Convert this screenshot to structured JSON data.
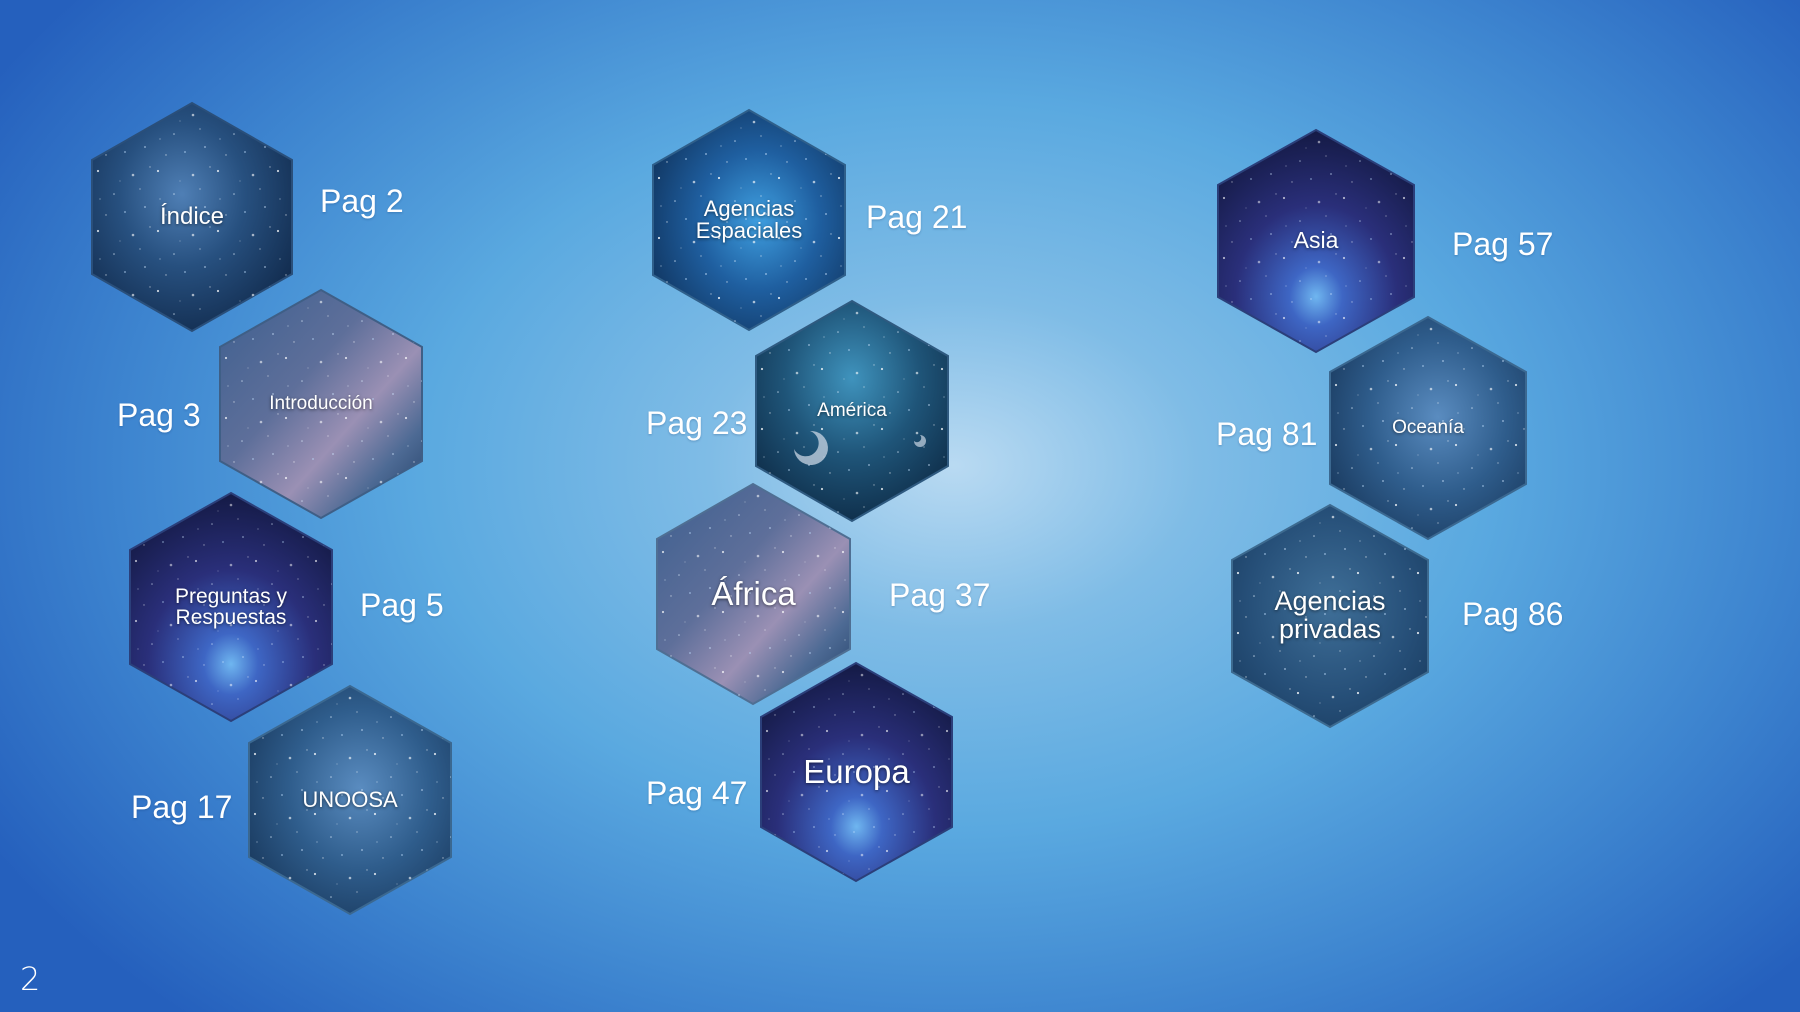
{
  "slide": {
    "number": "2"
  },
  "colors": {
    "text": "#ffffff",
    "background_center": "#b9daf2",
    "background_edge": "#2560bd"
  },
  "items": [
    {
      "id": "indice",
      "label": "Índice",
      "page": "Pag 2",
      "icon": "nebula-hexagon-icon"
    },
    {
      "id": "introduccion",
      "label": "Introducción",
      "page": "Pag 3",
      "icon": "milky-way-hexagon-icon"
    },
    {
      "id": "preguntas",
      "label": "Preguntas y\nRespuestas",
      "page": "Pag 5",
      "icon": "galaxy-hexagon-icon"
    },
    {
      "id": "unoosa",
      "label": "UNOOSA",
      "page": "Pag 17",
      "icon": "nebula-hexagon-icon"
    },
    {
      "id": "agencias-espaciales",
      "label": "Agencias\nEspaciales",
      "page": "Pag 21",
      "icon": "star-cluster-hexagon-icon"
    },
    {
      "id": "america",
      "label": "América",
      "page": "Pag 23",
      "icon": "planet-hexagon-icon"
    },
    {
      "id": "africa",
      "label": "África",
      "page": "Pag 37",
      "icon": "milky-way-hexagon-icon"
    },
    {
      "id": "europa",
      "label": "Europa",
      "page": "Pag 47",
      "icon": "galaxy-hexagon-icon"
    },
    {
      "id": "asia",
      "label": "Asia",
      "page": "Pag 57",
      "icon": "galaxy-hexagon-icon"
    },
    {
      "id": "oceania",
      "label": "Oceanía",
      "page": "Pag 81",
      "icon": "nebula-hexagon-icon"
    },
    {
      "id": "agencias-privadas",
      "label": "Agencias\nprivadas",
      "page": "Pag 86",
      "icon": "starfield-hexagon-icon"
    }
  ]
}
